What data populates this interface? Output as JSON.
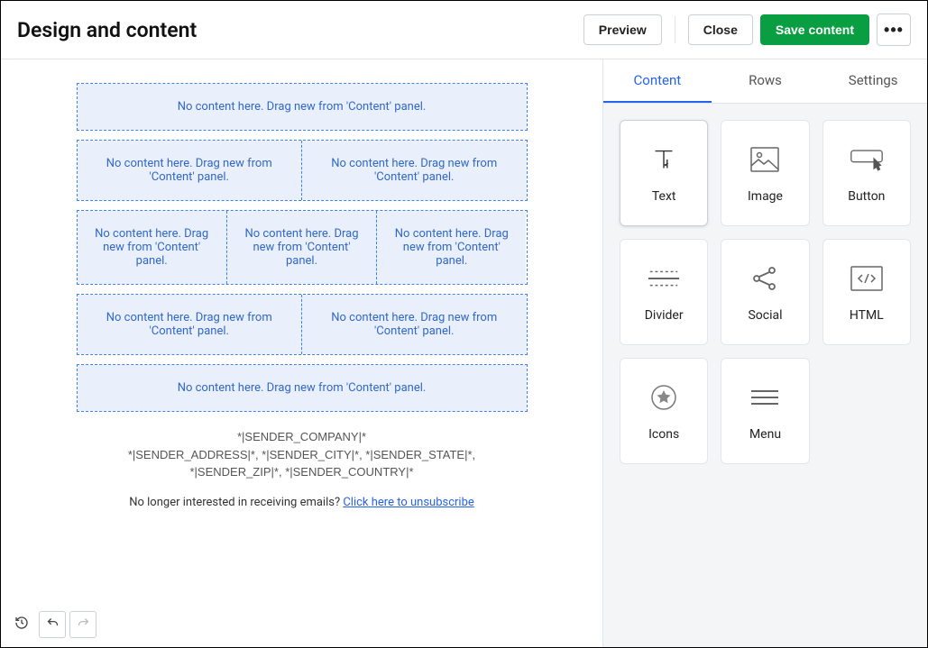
{
  "header": {
    "title": "Design and content",
    "preview": "Preview",
    "close": "Close",
    "save": "Save content",
    "more": "•••"
  },
  "canvas": {
    "placeholder": "No content here. Drag new from 'Content' panel.",
    "footer_line1": "*|SENDER_COMPANY|*",
    "footer_line2": "*|SENDER_ADDRESS|*, *|SENDER_CITY|*, *|SENDER_STATE|*,",
    "footer_line3": "*|SENDER_ZIP|*, *|SENDER_COUNTRY|*",
    "unsub_prefix": "No longer interested in receiving emails? ",
    "unsub_link": "Click here to unsubscribe"
  },
  "sidebar": {
    "tabs": {
      "content": "Content",
      "rows": "Rows",
      "settings": "Settings"
    },
    "blocks": {
      "text": "Text",
      "image": "Image",
      "button": "Button",
      "divider": "Divider",
      "social": "Social",
      "html": "HTML",
      "icons": "Icons",
      "menu": "Menu"
    }
  }
}
